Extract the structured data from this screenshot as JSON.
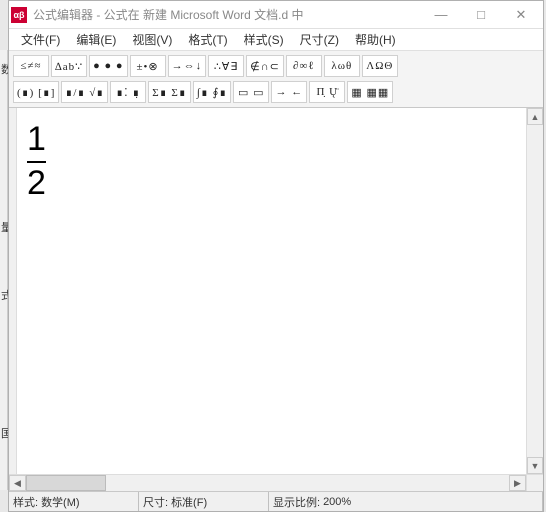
{
  "titlebar": {
    "app_icon_text": "αβ",
    "title": "公式编辑器 - 公式在 新建 Microsoft Word 文档.d 中",
    "min": "—",
    "max": "□",
    "close": "✕"
  },
  "menu": {
    "file": "文件(F)",
    "edit": "编辑(E)",
    "view": "视图(V)",
    "format": "格式(T)",
    "style": "样式(S)",
    "size": "尺寸(Z)",
    "help": "帮助(H)"
  },
  "toolbar": {
    "row1": {
      "b1": "≤≠≈",
      "b2": "∆ab∵",
      "b3": "● ● ●",
      "b4": "±•⊗",
      "b5": "→⇔↓",
      "b6": "∴∀∃",
      "b7": "∉∩⊂",
      "b8": "∂∞ℓ",
      "b9": "λωθ",
      "b10": "ΛΩΘ"
    },
    "row2": {
      "b1": "(∎) [∎]",
      "b2": "∎/∎ √∎",
      "b3": "∎⁚ ∎̣",
      "b4": "Σ∎ Σ∎",
      "b5": "∫∎ ∮∎",
      "b6": "▭ ▭",
      "b7": "→ ←",
      "b8": "Π̣ Ų̈",
      "b9": "▦ ▦▦"
    }
  },
  "equation": {
    "numerator": "1",
    "denominator": "2"
  },
  "scroll": {
    "up": "▲",
    "down": "▼",
    "left": "◀",
    "right": "▶"
  },
  "status": {
    "style_label": "样式:",
    "style_value": "数学(M)",
    "size_label": "尺寸:",
    "size_value": "标准(F)",
    "zoom_label": "显示比例:",
    "zoom_value": "200%"
  },
  "sidecrop": {
    "a": "数",
    "b": "量",
    "c": "式",
    "d": "国"
  }
}
